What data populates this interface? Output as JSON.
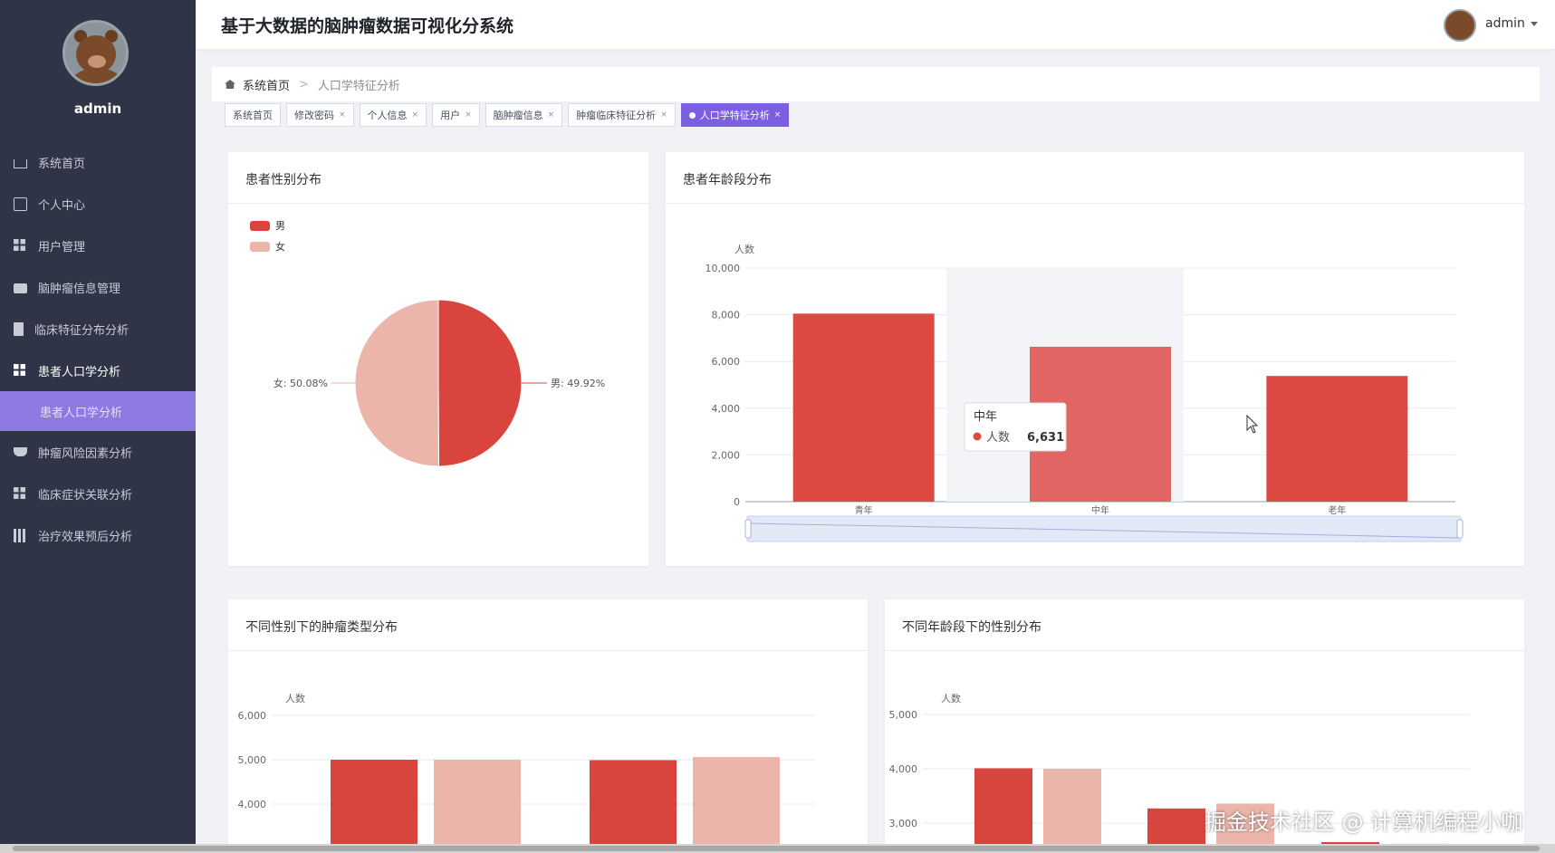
{
  "app": {
    "title": "基于大数据的脑肿瘤数据可视化分系统"
  },
  "header": {
    "user": "admin"
  },
  "sidebar": {
    "user": "admin",
    "items": [
      {
        "label": "系统首页",
        "icon": "home-icon"
      },
      {
        "label": "个人中心",
        "icon": "card-icon"
      },
      {
        "label": "用户管理",
        "icon": "grid-icon"
      },
      {
        "label": "脑肿瘤信息管理",
        "icon": "briefcase-icon"
      },
      {
        "label": "临床特征分布分析",
        "icon": "clipboard-icon"
      },
      {
        "label": "患者人口学分析",
        "icon": "grid-icon"
      },
      {
        "label": "肿瘤风险因素分析",
        "icon": "drop-icon"
      },
      {
        "label": "临床症状关联分析",
        "icon": "grid-icon"
      },
      {
        "label": "治疗效果预后分析",
        "icon": "books-icon"
      }
    ],
    "sub_item": "患者人口学分析"
  },
  "breadcrumb": {
    "home": "系统首页",
    "current": "人口学特征分析"
  },
  "tags": [
    {
      "label": "系统首页",
      "closable": false,
      "active": false
    },
    {
      "label": "修改密码",
      "closable": true,
      "active": false
    },
    {
      "label": "个人信息",
      "closable": true,
      "active": false
    },
    {
      "label": "用户",
      "closable": true,
      "active": false
    },
    {
      "label": "脑肿瘤信息",
      "closable": true,
      "active": false
    },
    {
      "label": "肿瘤临床特征分析",
      "closable": true,
      "active": false
    },
    {
      "label": "人口学特征分析",
      "closable": true,
      "active": true
    }
  ],
  "tag_close": "×",
  "crumb_sep": ">",
  "colors": {
    "male": "#d9443f",
    "female": "#ebb5aa",
    "bar": "#dd4a44",
    "bar_hover": "#e06563",
    "accent": "#7b5fe0"
  },
  "cards": {
    "gender": {
      "title": "患者性别分布",
      "legend": [
        "男",
        "女"
      ],
      "labels": {
        "male": "男: 49.92%",
        "female": "女: 50.08%"
      }
    },
    "age": {
      "title": "患者年龄段分布",
      "ylabel": "人数",
      "tooltip": {
        "title": "中年",
        "series": "人数",
        "value": "6,631"
      }
    },
    "tumor_by_gender": {
      "title": "不同性别下的肿瘤类型分布",
      "ylabel": "人数"
    },
    "gender_by_age": {
      "title": "不同年龄段下的性别分布",
      "ylabel": "人数"
    }
  },
  "chart_data": [
    {
      "type": "pie",
      "title": "患者性别分布",
      "categories": [
        "男",
        "女"
      ],
      "values": [
        49.92,
        50.08
      ],
      "unit": "%",
      "legend_position": "top-left"
    },
    {
      "type": "bar",
      "title": "患者年龄段分布",
      "ylabel": "人数",
      "categories": [
        "青年",
        "中年",
        "老年"
      ],
      "values": [
        8050,
        6631,
        5380
      ],
      "ylim": [
        0,
        10000
      ],
      "yticks": [
        "0",
        "2,000",
        "4,000",
        "6,000",
        "8,000",
        "10,000"
      ],
      "grid": true,
      "datazoom": true
    },
    {
      "type": "bar",
      "title": "不同性别下的肿瘤类型分布",
      "ylabel": "人数",
      "series_colors": [
        "#d9443f",
        "#ebb5aa",
        "#d9443f",
        "#ebb5aa"
      ],
      "values": [
        5000,
        5000,
        4990,
        5060
      ],
      "yticks": [
        "4,000",
        "5,000",
        "6,000"
      ],
      "ylim_visible": [
        3500,
        6200
      ]
    },
    {
      "type": "bar",
      "title": "不同年龄段下的性别分布",
      "ylabel": "人数",
      "series_colors": [
        "#d9443f",
        "#ebb5aa",
        "#d9443f",
        "#ebb5aa",
        "#d9443f",
        "#ebb5aa"
      ],
      "values": [
        4010,
        4000,
        3270,
        3360,
        2650,
        2620
      ],
      "yticks": [
        "3,000",
        "4,000",
        "5,000"
      ],
      "ylim_visible": [
        2600,
        5200
      ]
    }
  ],
  "watermark": "掘金技术社区 @ 计算机编程小咖"
}
